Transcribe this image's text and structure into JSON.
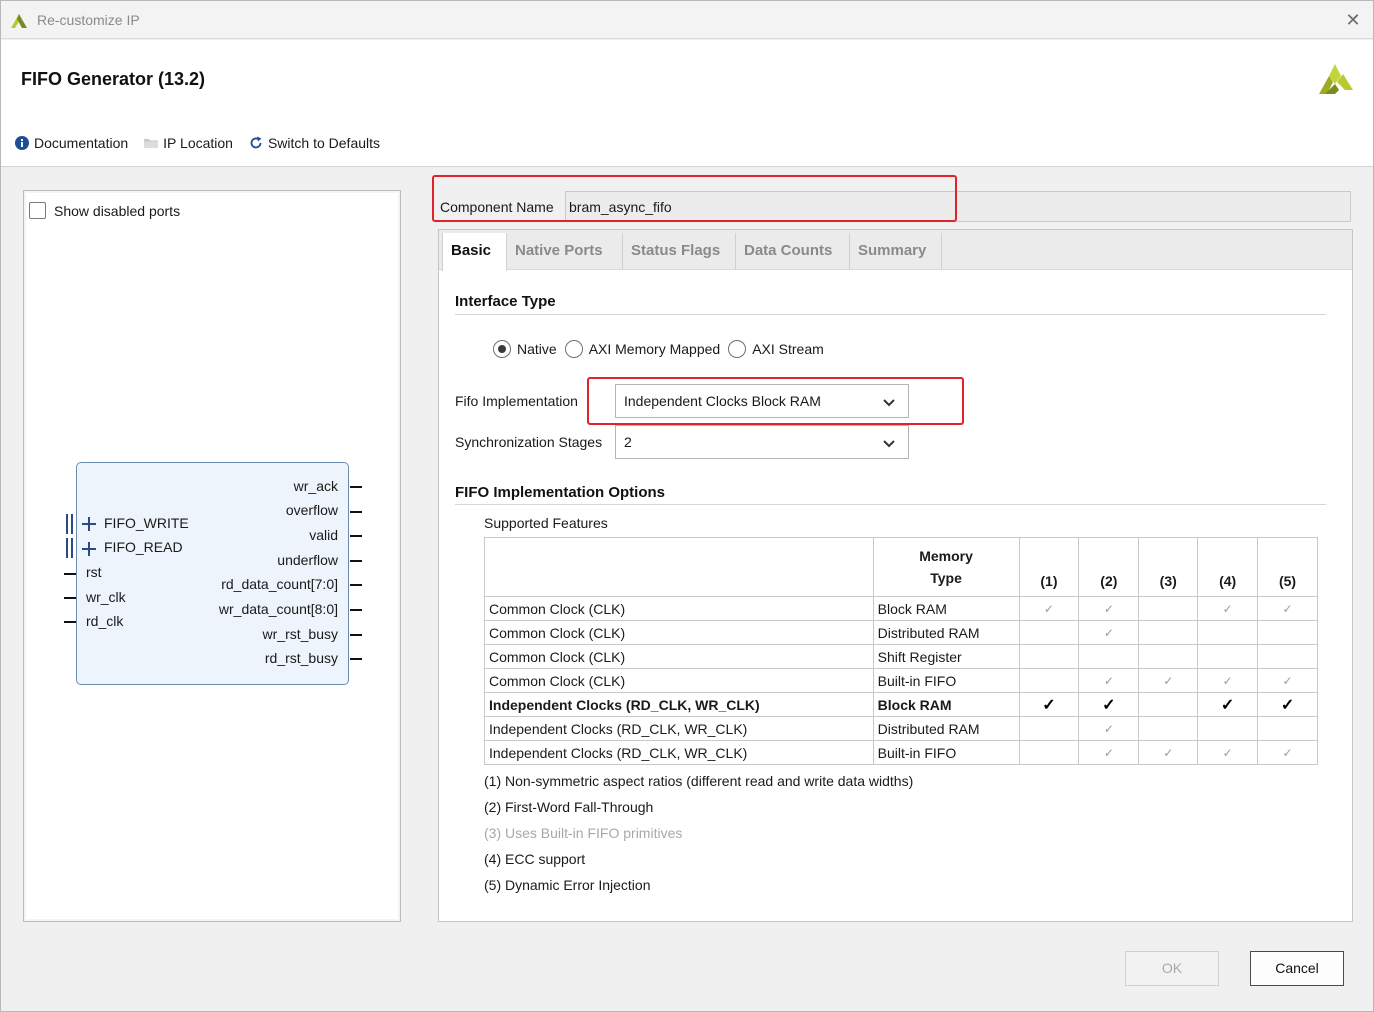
{
  "window": {
    "title": "Re-customize IP",
    "close_glyph": "✕"
  },
  "header": {
    "generator_title": "FIFO Generator (13.2)",
    "toolbar": [
      {
        "label": "Documentation",
        "icon": "info-icon"
      },
      {
        "label": "IP Location",
        "icon": "folder-icon"
      },
      {
        "label": "Switch to Defaults",
        "icon": "refresh-icon"
      }
    ]
  },
  "left_panel": {
    "show_disabled_ports_label": "Show disabled ports",
    "show_disabled_ports_checked": false,
    "block": {
      "left_bus_ports": [
        "FIFO_WRITE",
        "FIFO_READ"
      ],
      "left_ports": [
        "rst",
        "wr_clk",
        "rd_clk"
      ],
      "right_ports": [
        "wr_ack",
        "overflow",
        "valid",
        "underflow",
        "rd_data_count[7:0]",
        "wr_data_count[8:0]",
        "wr_rst_busy",
        "rd_rst_busy"
      ]
    }
  },
  "component": {
    "label": "Component Name",
    "value": "bram_async_fifo"
  },
  "tabs": [
    {
      "label": "Basic",
      "active": true
    },
    {
      "label": "Native Ports",
      "active": false
    },
    {
      "label": "Status Flags",
      "active": false
    },
    {
      "label": "Data Counts",
      "active": false
    },
    {
      "label": "Summary",
      "active": false
    }
  ],
  "basic": {
    "interface_type_title": "Interface Type",
    "interface_options": [
      {
        "label": "Native",
        "selected": true
      },
      {
        "label": "AXI Memory Mapped",
        "selected": false
      },
      {
        "label": "AXI Stream",
        "selected": false
      }
    ],
    "fifo_impl_label": "Fifo Implementation",
    "fifo_impl_value": "Independent Clocks Block RAM",
    "sync_stages_label": "Synchronization Stages",
    "sync_stages_value": "2",
    "impl_options_title": "FIFO Implementation Options",
    "supported_features_label": "Supported Features",
    "table": {
      "memory_type_header_line1": "Memory",
      "memory_type_header_line2": "Type",
      "feature_headers": [
        "(1)",
        "(2)",
        "(3)",
        "(4)",
        "(5)"
      ],
      "rows": [
        {
          "clock": "Common Clock (CLK)",
          "memory": "Block RAM",
          "checks": [
            true,
            true,
            false,
            true,
            true
          ],
          "selected": false
        },
        {
          "clock": "Common Clock (CLK)",
          "memory": "Distributed RAM",
          "checks": [
            false,
            true,
            false,
            false,
            false
          ],
          "selected": false
        },
        {
          "clock": "Common Clock (CLK)",
          "memory": "Shift Register",
          "checks": [
            false,
            false,
            false,
            false,
            false
          ],
          "selected": false
        },
        {
          "clock": "Common Clock (CLK)",
          "memory": "Built-in FIFO",
          "checks": [
            false,
            true,
            true,
            true,
            true
          ],
          "selected": false
        },
        {
          "clock": "Independent Clocks (RD_CLK, WR_CLK)",
          "memory": "Block RAM",
          "checks": [
            true,
            true,
            false,
            true,
            true
          ],
          "selected": true
        },
        {
          "clock": "Independent Clocks (RD_CLK, WR_CLK)",
          "memory": "Distributed RAM",
          "checks": [
            false,
            true,
            false,
            false,
            false
          ],
          "selected": false
        },
        {
          "clock": "Independent Clocks (RD_CLK, WR_CLK)",
          "memory": "Built-in FIFO",
          "checks": [
            false,
            true,
            true,
            true,
            true
          ],
          "selected": false
        }
      ]
    },
    "notes": [
      {
        "text": "(1) Non-symmetric aspect ratios (different read and write data widths)",
        "disabled": false
      },
      {
        "text": "(2) First-Word Fall-Through",
        "disabled": false
      },
      {
        "text": "(3) Uses Built-in FIFO primitives",
        "disabled": true
      },
      {
        "text": "(4) ECC support",
        "disabled": false
      },
      {
        "text": "(5) Dynamic Error Injection",
        "disabled": false
      }
    ]
  },
  "buttons": {
    "ok": "OK",
    "cancel": "Cancel"
  },
  "colors": {
    "highlight_red": "#e0222a",
    "block_fill": "#eef4fb",
    "block_border": "#6b8db5",
    "xilinx_logo": "#b8c932"
  }
}
